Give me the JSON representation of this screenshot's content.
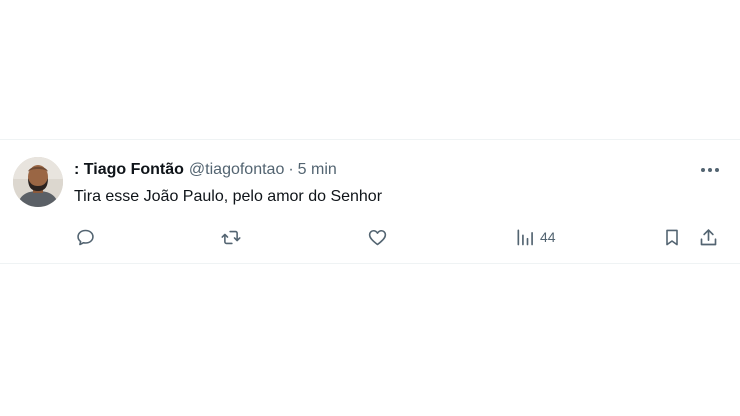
{
  "tweet": {
    "author_name": ": Tiago Fontão",
    "handle": "@tiagofontao",
    "separator": "·",
    "time": "5 min",
    "text": "Tira esse João Paulo, pelo amor do Senhor",
    "views": "44"
  },
  "icons": {
    "more": "more-horizontal-icon",
    "reply": "reply-bubble-icon",
    "retweet": "retweet-icon",
    "like": "heart-icon",
    "views": "bar-chart-icon",
    "bookmark": "bookmark-icon",
    "share": "share-upload-icon"
  },
  "colors": {
    "text_primary": "#0f1419",
    "text_secondary": "#536471",
    "divider": "#eff3f4"
  }
}
